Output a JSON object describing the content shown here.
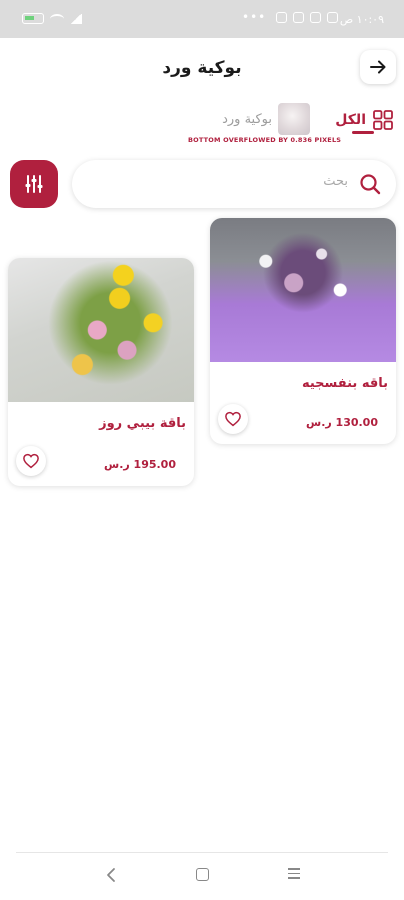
{
  "status_bar": {
    "time": "١٠:٠٩ ص",
    "icons": [
      "alarm-icon",
      "telegram-icon",
      "chat-icon",
      "instagram-icon",
      "more-dots-icon",
      "signal-icon",
      "wifi-icon",
      "battery-icon"
    ]
  },
  "header": {
    "title": "بوكية ورد",
    "back_icon": "arrow-right-icon"
  },
  "categories": [
    {
      "label": "الكل",
      "active": true,
      "icon": "grid-icon"
    },
    {
      "label": "بوكية ورد",
      "active": false
    }
  ],
  "overflow_warning": "BOTTOM OVERFLOWED BY 0.836 PIXELS",
  "search": {
    "placeholder": "بحث",
    "icon": "search-icon"
  },
  "filter_button_icon": "sliders-icon",
  "products": [
    {
      "name": "باقه بنفسجيه",
      "price": "130.00 ر.س",
      "favorite_icon": "heart-icon"
    },
    {
      "name": "باقة بيبي روز",
      "price": "195.00 ر.س",
      "favorite_icon": "heart-icon"
    }
  ],
  "colors": {
    "accent": "#b0203e",
    "background": "#ffffff",
    "status_bar": "#dcdcdc"
  },
  "nav": {
    "back": "back-icon",
    "home": "home-icon",
    "recents": "recents-icon"
  }
}
